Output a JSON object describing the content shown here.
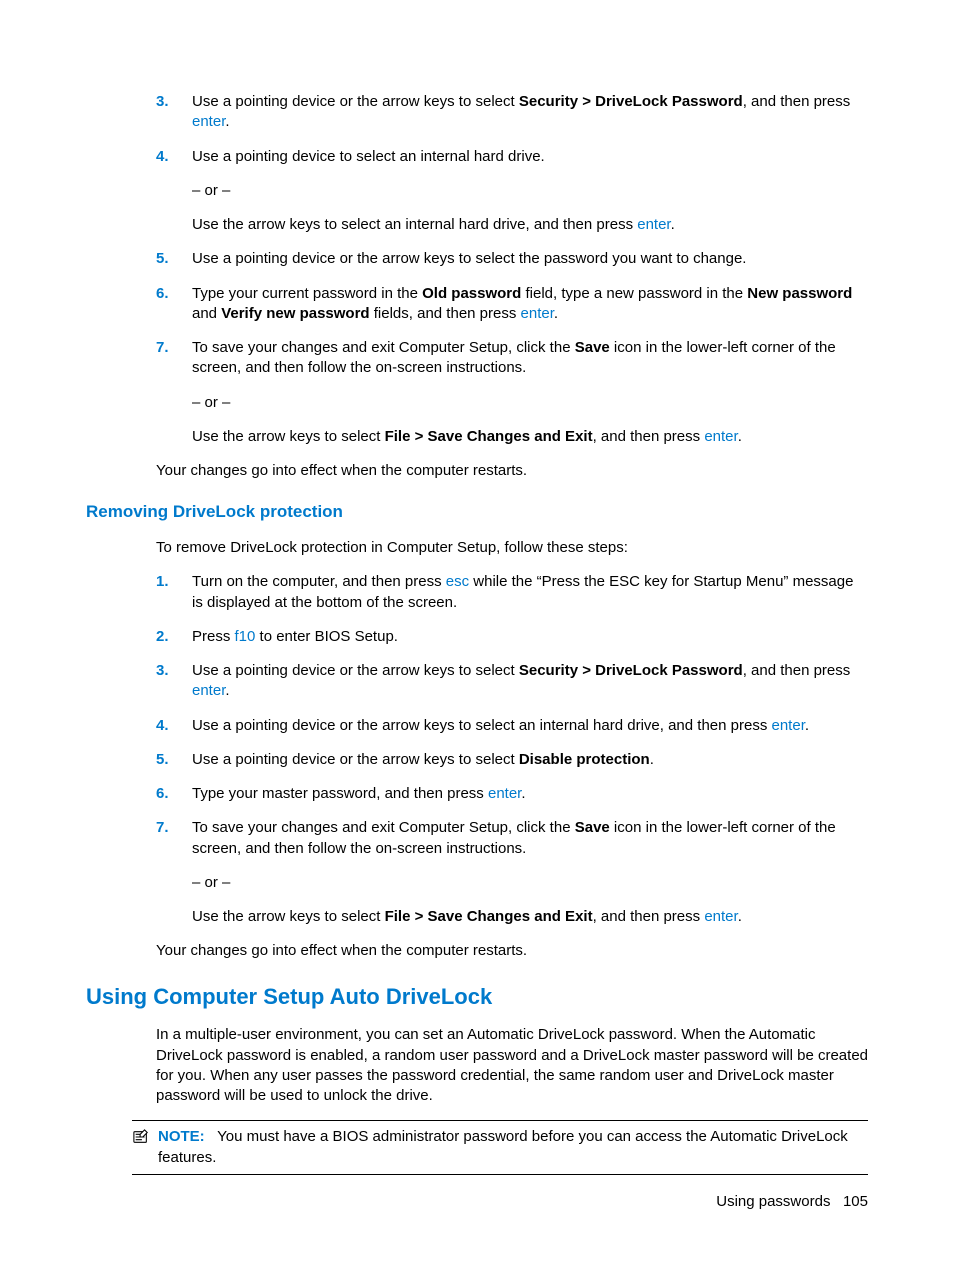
{
  "list1": {
    "start": 3,
    "items": [
      {
        "pre": "Use a pointing device or the arrow keys to select ",
        "bold1": "Security > DriveLock Password",
        "mid": ", and then press ",
        "key1": "enter",
        "post": "."
      },
      {
        "line1": "Use a pointing device to select an internal hard drive.",
        "or": "– or –",
        "line2a": "Use the arrow keys to select an internal hard drive, and then press ",
        "key1": "enter",
        "line2b": "."
      },
      {
        "line": "Use a pointing device or the arrow keys to select the password you want to change."
      },
      {
        "pre": "Type your current password in the ",
        "bold1": "Old password",
        "mid1": " field, type a new password in the ",
        "bold2": "New password",
        "mid2": " and ",
        "bold3": "Verify new password",
        "mid3": " fields, and then press ",
        "key1": "enter",
        "post": "."
      },
      {
        "line1a": "To save your changes and exit Computer Setup, click the ",
        "bold1": "Save",
        "line1b": " icon in the lower-left corner of the screen, and then follow the on-screen instructions.",
        "or": "– or –",
        "line2a": "Use the arrow keys to select ",
        "bold2": "File > Save Changes and Exit",
        "line2b": ", and then press ",
        "key1": "enter",
        "line2c": "."
      }
    ]
  },
  "closing1": "Your changes go into effect when the computer restarts.",
  "heading_remove": "Removing DriveLock protection",
  "remove_intro": "To remove DriveLock protection in Computer Setup, follow these steps:",
  "list2": {
    "items": [
      {
        "pre": "Turn on the computer, and then press ",
        "key1": "esc",
        "post": " while the “Press the ESC key for Startup Menu” message is displayed at the bottom of the screen."
      },
      {
        "pre": "Press ",
        "key1": "f10",
        "post": " to enter BIOS Setup."
      },
      {
        "pre": "Use a pointing device or the arrow keys to select ",
        "bold1": "Security > DriveLock Password",
        "mid": ", and then press ",
        "key1": "enter",
        "post": "."
      },
      {
        "pre": "Use a pointing device or the arrow keys to select an internal hard drive, and then press ",
        "key1": "enter",
        "post": "."
      },
      {
        "pre": "Use a pointing device or the arrow keys to select ",
        "bold1": "Disable protection",
        "post": "."
      },
      {
        "pre": "Type your master password, and then press ",
        "key1": "enter",
        "post": "."
      },
      {
        "line1a": "To save your changes and exit Computer Setup, click the ",
        "bold1": "Save",
        "line1b": " icon in the lower-left corner of the screen, and then follow the on-screen instructions.",
        "or": "– or –",
        "line2a": "Use the arrow keys to select ",
        "bold2": "File > Save Changes and Exit",
        "line2b": ", and then press ",
        "key1": "enter",
        "line2c": "."
      }
    ]
  },
  "closing2": "Your changes go into effect when the computer restarts.",
  "heading_auto": "Using Computer Setup Auto DriveLock",
  "auto_para": "In a multiple-user environment, you can set an Automatic DriveLock password. When the Automatic DriveLock password is enabled, a random user password and a DriveLock master password will be created for you. When any user passes the password credential, the same random user and DriveLock master password will be used to unlock the drive.",
  "note_label": "NOTE:",
  "note_text": "   You must have a BIOS administrator password before you can access the Automatic DriveLock features.",
  "footer_text": "Using passwords",
  "page_number": "105"
}
